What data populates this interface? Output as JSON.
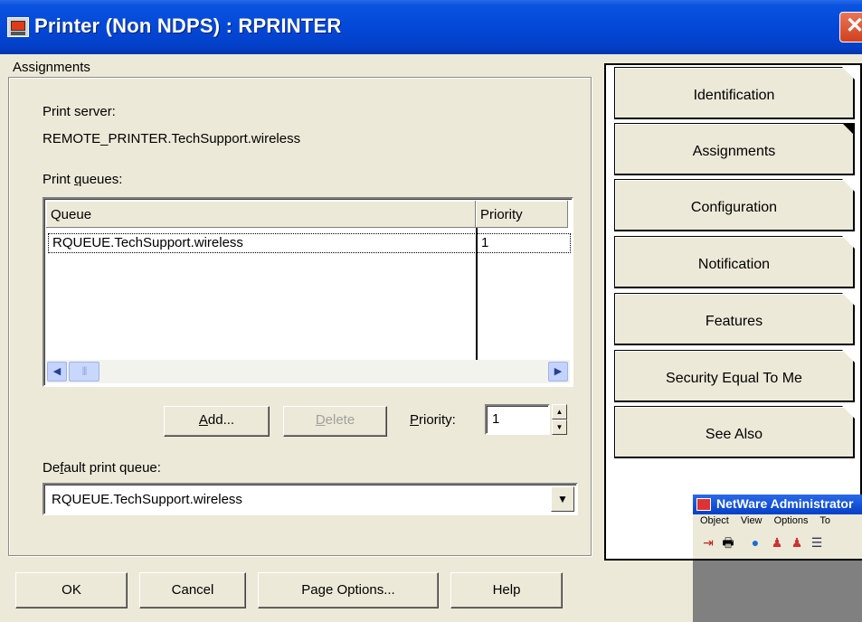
{
  "window": {
    "title": "Printer (Non NDPS) : RPRINTER",
    "close_glyph": "✕"
  },
  "group": {
    "title": "Assignments"
  },
  "print_server": {
    "label": "Print server:",
    "value": "REMOTE_PRINTER.TechSupport.wireless"
  },
  "print_queues": {
    "label_pre": "Print ",
    "label_u": "q",
    "label_post": "ueues:",
    "columns": [
      "Queue",
      "Priority"
    ],
    "rows": [
      {
        "queue": "RQUEUE.TechSupport.wireless",
        "priority": "1"
      }
    ]
  },
  "buttons": {
    "add_u": "A",
    "add_rest": "dd...",
    "delete_u": "D",
    "delete_rest": "elete",
    "ok": "OK",
    "cancel": "Cancel",
    "page_options": "Page Options...",
    "help": "Help"
  },
  "priority": {
    "label_u": "P",
    "label_rest": "riority:",
    "value": "1"
  },
  "default_queue": {
    "label_pre": "De",
    "label_u": "f",
    "label_post": "ault print queue:",
    "value": "RQUEUE.TechSupport.wireless"
  },
  "pages": [
    {
      "label": "Identification",
      "active": false
    },
    {
      "label": "Assignments",
      "active": true
    },
    {
      "label": "Configuration",
      "active": false
    },
    {
      "label": "Notification",
      "active": false
    },
    {
      "label": "Features",
      "active": false
    },
    {
      "label": "Security Equal To Me",
      "active": false
    },
    {
      "label": "See Also",
      "active": false
    }
  ],
  "background_app": {
    "title": "NetWare Administrator",
    "menu": [
      "Object",
      "View",
      "Options",
      "To"
    ]
  },
  "icons": {
    "scroll_left": "arrow-left-icon",
    "scroll_right": "arrow-right-icon",
    "spin_up": "triangle-up-icon",
    "spin_down": "triangle-down-icon",
    "combo": "triangle-down-icon"
  }
}
